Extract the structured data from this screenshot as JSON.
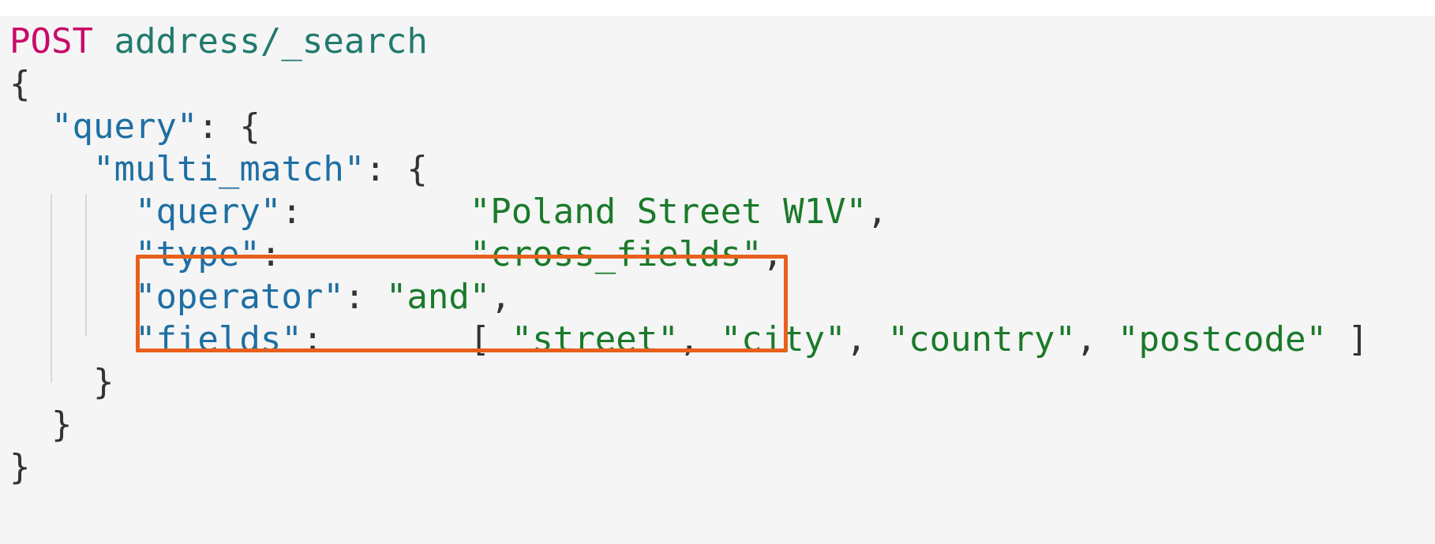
{
  "request": {
    "method": "POST",
    "path": "address/_search"
  },
  "body": {
    "open_brace": "{",
    "query_key": "\"query\"",
    "multi_match_key": "\"multi_match\"",
    "fields": {
      "query_key": "\"query\"",
      "query_value": "\"Poland Street W1V\"",
      "type_key": "\"type\"",
      "type_value": "\"cross_fields\"",
      "operator_key": "\"operator\"",
      "operator_value": "\"and\"",
      "fields_key": "\"fields\"",
      "fields_values": [
        "\"street\"",
        "\"city\"",
        "\"country\"",
        "\"postcode\""
      ]
    },
    "close_brace": "}"
  },
  "highlight": {
    "color": "#e8601c",
    "covers": [
      "type",
      "operator"
    ]
  },
  "colors": {
    "method": "#c80a68",
    "path": "#217a6e",
    "key": "#1f6fa3",
    "string": "#1a7a2a",
    "background": "#f5f5f5"
  }
}
